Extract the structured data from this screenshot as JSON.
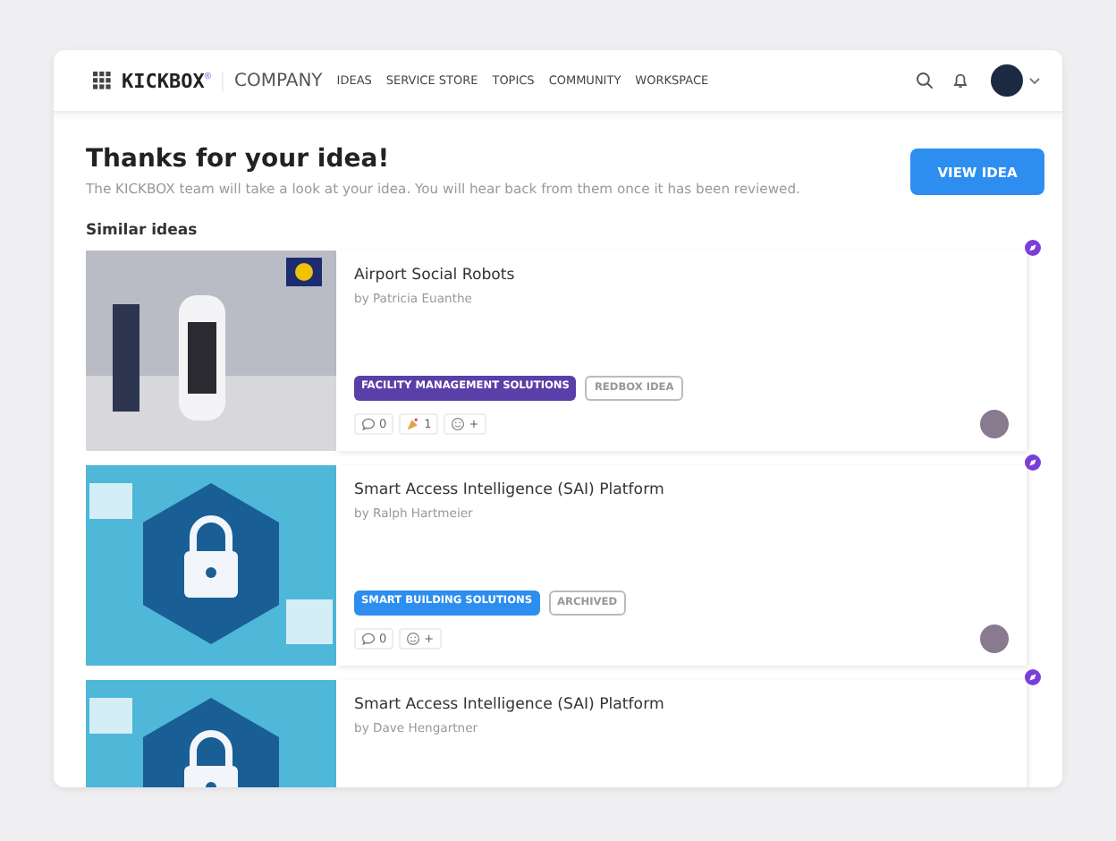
{
  "header": {
    "logo": "KICKBOX$^{®}$",
    "company": "COMPANY",
    "nav": [
      {
        "label": "IDEAS"
      },
      {
        "label": "SERVICE STORE"
      },
      {
        "label": "TOPICS"
      },
      {
        "label": "COMMUNITY"
      },
      {
        "label": "WORKSPACE"
      }
    ]
  },
  "confirmation": {
    "title": "Thanks for your idea!",
    "message": "The KICKBOX team will take a look at your idea. You will hear back from them once it has been reviewed.",
    "button": "VIEW IDEA"
  },
  "similar": {
    "heading": "Similar ideas",
    "ideas": [
      {
        "title": "Airport Social Robots",
        "author": "by Patricia Euanthe",
        "kind": "robot",
        "tags": [
          {
            "label": "FACILITY MANAGEMENT SOLUTIONS",
            "kind": "filled",
            "color": "#5b3fa8"
          },
          {
            "label": "REDBOX IDEA",
            "kind": "outline"
          }
        ],
        "reactions": [
          {
            "kind": "comment",
            "count": "0"
          },
          {
            "kind": "celebrate",
            "count": "1"
          },
          {
            "kind": "add",
            "count": "+"
          }
        ]
      },
      {
        "title": "Smart Access Intelligence (SAI) Platform",
        "author": "by Ralph Hartmeier",
        "kind": "lock",
        "tags": [
          {
            "label": "SMART BUILDING SOLUTIONS",
            "kind": "filled",
            "color": "#2d8ef0"
          },
          {
            "label": "ARCHIVED",
            "kind": "outline"
          }
        ],
        "reactions": [
          {
            "kind": "comment",
            "count": "0"
          },
          {
            "kind": "add",
            "count": "+"
          }
        ]
      },
      {
        "title": "Smart Access Intelligence (SAI) Platform",
        "author": "by Dave Hengartner",
        "kind": "lock"
      }
    ]
  }
}
